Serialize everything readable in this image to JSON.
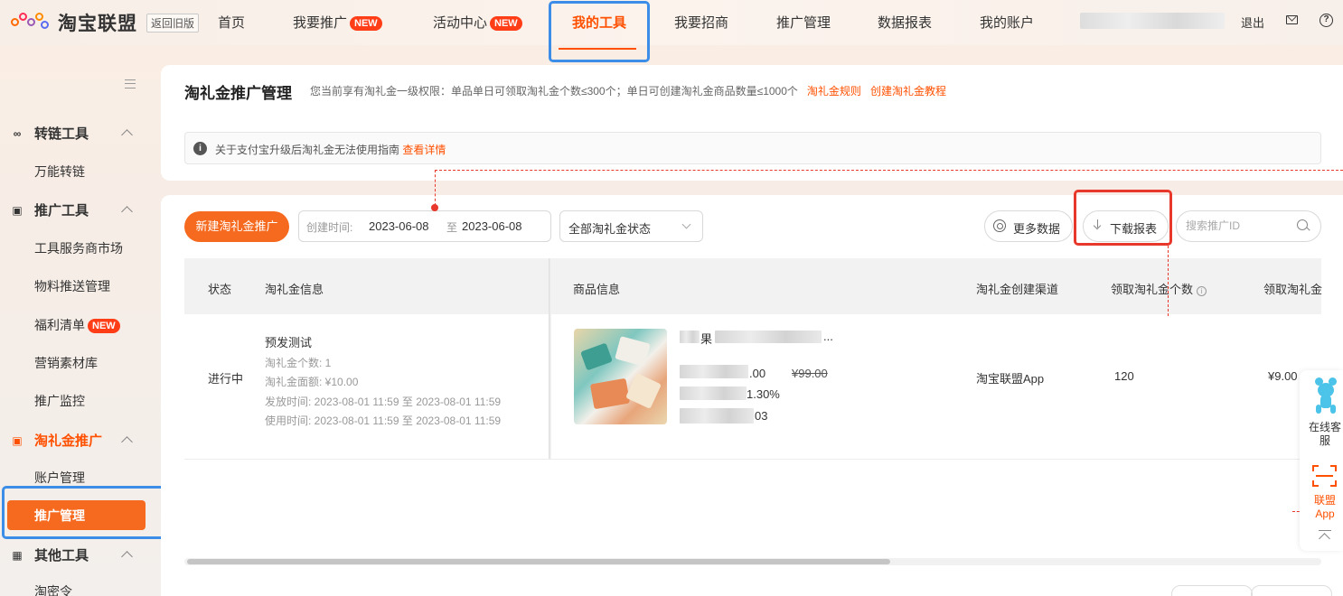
{
  "brand": {
    "name": "淘宝联盟",
    "back_old": "返回旧版"
  },
  "nav": {
    "items": [
      {
        "label": "首页"
      },
      {
        "label": "我要推广",
        "badge": "NEW"
      },
      {
        "label": "活动中心",
        "badge": "NEW"
      },
      {
        "label": "我的工具",
        "active": true
      },
      {
        "label": "我要招商"
      },
      {
        "label": "推广管理"
      },
      {
        "label": "数据报表"
      },
      {
        "label": "我的账户"
      }
    ],
    "logout": "退出"
  },
  "sidebar": {
    "groups": [
      {
        "label": "转链工具",
        "icon": "link-icon",
        "items": [
          "万能转链"
        ]
      },
      {
        "label": "推广工具",
        "icon": "toolbox-icon",
        "items": [
          "工具服务商市场",
          "物料推送管理",
          "福利清单",
          "营销素材库",
          "推广监控"
        ],
        "badge_item": "福利清单",
        "badge": "NEW"
      },
      {
        "label": "淘礼金推广",
        "icon": "gift-icon",
        "items": [
          "账户管理",
          "推广管理"
        ],
        "active_item": "推广管理"
      },
      {
        "label": "其他工具",
        "icon": "image-icon",
        "items": [
          "淘密令"
        ]
      }
    ]
  },
  "header": {
    "title": "淘礼金推广管理",
    "quota_text": "您当前享有淘礼金一级权限：单品单日可领取淘礼金个数≤300个；单日可创建淘礼金商品数量≤1000个",
    "rules_link": "淘礼金规则",
    "tutorial_link": "创建淘礼金教程",
    "notice_text": "关于支付宝升级后淘礼金无法使用指南",
    "notice_link": "查看详情"
  },
  "toolbar": {
    "new_button": "新建淘礼金推广",
    "date_label": "创建时间:",
    "date_start": "2023-06-08",
    "date_sep": "至",
    "date_end": "2023-06-08",
    "status_select": "全部淘礼金状态",
    "more_button": "更多数据",
    "download_button": "下载报表",
    "search_placeholder": "搜索推广ID"
  },
  "table": {
    "columns": [
      "状态",
      "淘礼金信息",
      "商品信息",
      "淘礼金创建渠道",
      "领取淘礼金个数",
      "领取淘礼金"
    ],
    "rows": [
      {
        "status": "进行中",
        "name": "预发测试",
        "count_line": "淘礼金个数: 1",
        "amount_line": "淘礼金面额: ¥10.00",
        "issue_line": "发放时间: 2023-08-01 11:59 至 2023-08-01 11:59",
        "use_line": "使用时间: 2023-08-01 11:59 至 2023-08-01 11:59",
        "product_title_fragment": "果",
        "product_title_ellipsis": "...",
        "price_fragment": ".00",
        "old_price": "¥99.00",
        "rate_fragment": "1.30%",
        "id_fragment": "03",
        "channel": "淘宝联盟App",
        "claimed_count": "120",
        "claimed_amount": "¥9.00"
      }
    ]
  },
  "float_panel": {
    "service_label": "在线客服",
    "app_label": "联盟App"
  },
  "colors": {
    "accent": "#ff5000",
    "button": "#f56a1e",
    "highlight_blue": "#3c8de8",
    "highlight_red": "#e8382c"
  }
}
